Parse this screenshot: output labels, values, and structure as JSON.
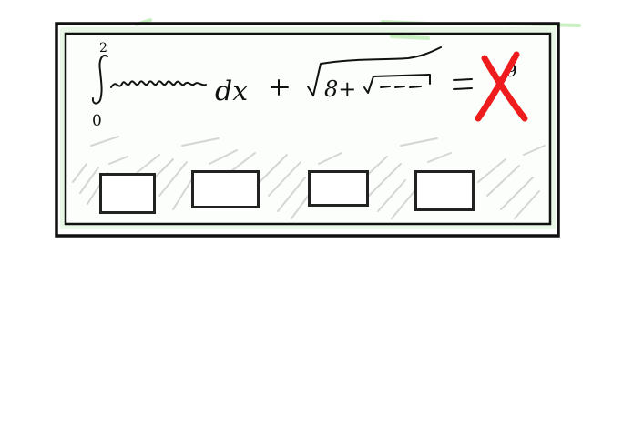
{
  "puzzle": {
    "integral_lower_limit": "0",
    "integral_upper_limit": "2",
    "differential": "dx",
    "plus_sign": "+",
    "sqrt_inner_text": "8+",
    "equals_sign": "=",
    "result_digit": "9"
  },
  "status": {
    "icon": "x-mark-icon",
    "color": "#ee1c1c"
  },
  "answer_slots": [
    {
      "value": ""
    },
    {
      "value": ""
    },
    {
      "value": ""
    },
    {
      "value": ""
    }
  ],
  "colors": {
    "frame": "#111111",
    "panel_background": "#e9f8e6",
    "panel_hatch": "#cfcfcf",
    "slot_border": "#222222"
  }
}
